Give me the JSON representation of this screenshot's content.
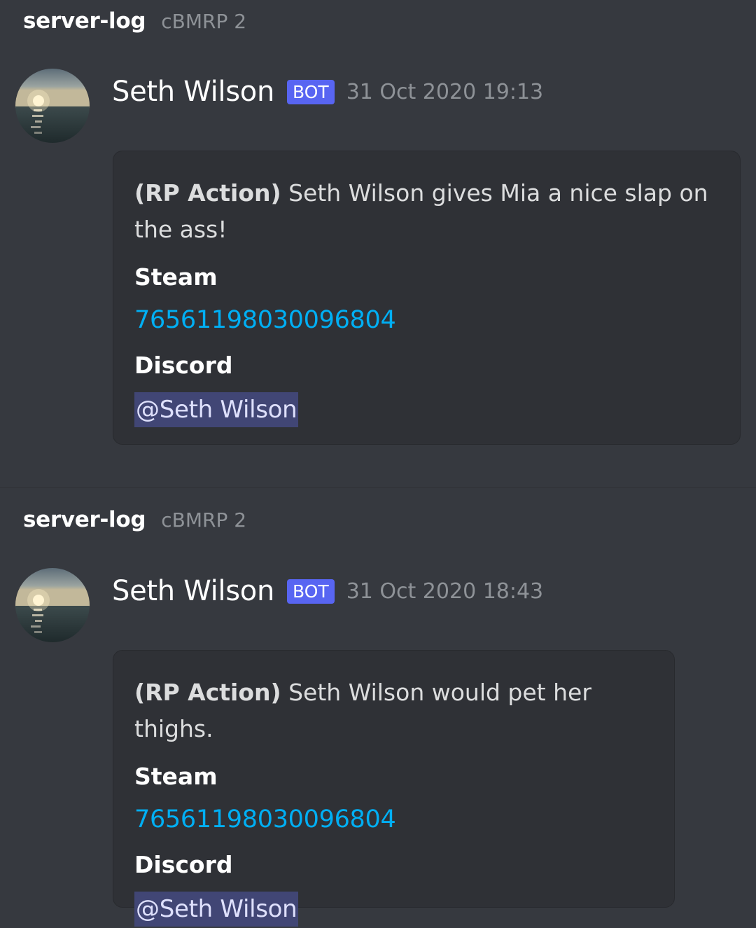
{
  "messages": [
    {
      "channel": "server-log",
      "server": "cBMRP 2",
      "author": "Seth Wilson",
      "tag": "BOT",
      "timestamp": "31 Oct 2020 19:13",
      "embed": {
        "label": "(RP Action)",
        "text": " Seth Wilson gives Mia a nice slap on the ass!",
        "fields": [
          {
            "name": "Steam",
            "value": "76561198030096804"
          },
          {
            "name": "Discord",
            "value": "@Seth Wilson"
          }
        ]
      }
    },
    {
      "channel": "server-log",
      "server": "cBMRP 2",
      "author": "Seth Wilson",
      "tag": "BOT",
      "timestamp": "31 Oct 2020 18:43",
      "embed": {
        "label": "(RP Action)",
        "text": " Seth Wilson would pet her thighs.",
        "fields": [
          {
            "name": "Steam",
            "value": "76561198030096804"
          },
          {
            "name": "Discord",
            "value": "@Seth Wilson"
          }
        ]
      }
    }
  ],
  "colors": {
    "background": "#36393f",
    "embed_background": "#2f3136",
    "link": "#00aff4",
    "bot_tag": "#5865f2",
    "mention_background": "#414675"
  },
  "icons": {
    "avatar": "sunset-over-sea-avatar-icon"
  }
}
